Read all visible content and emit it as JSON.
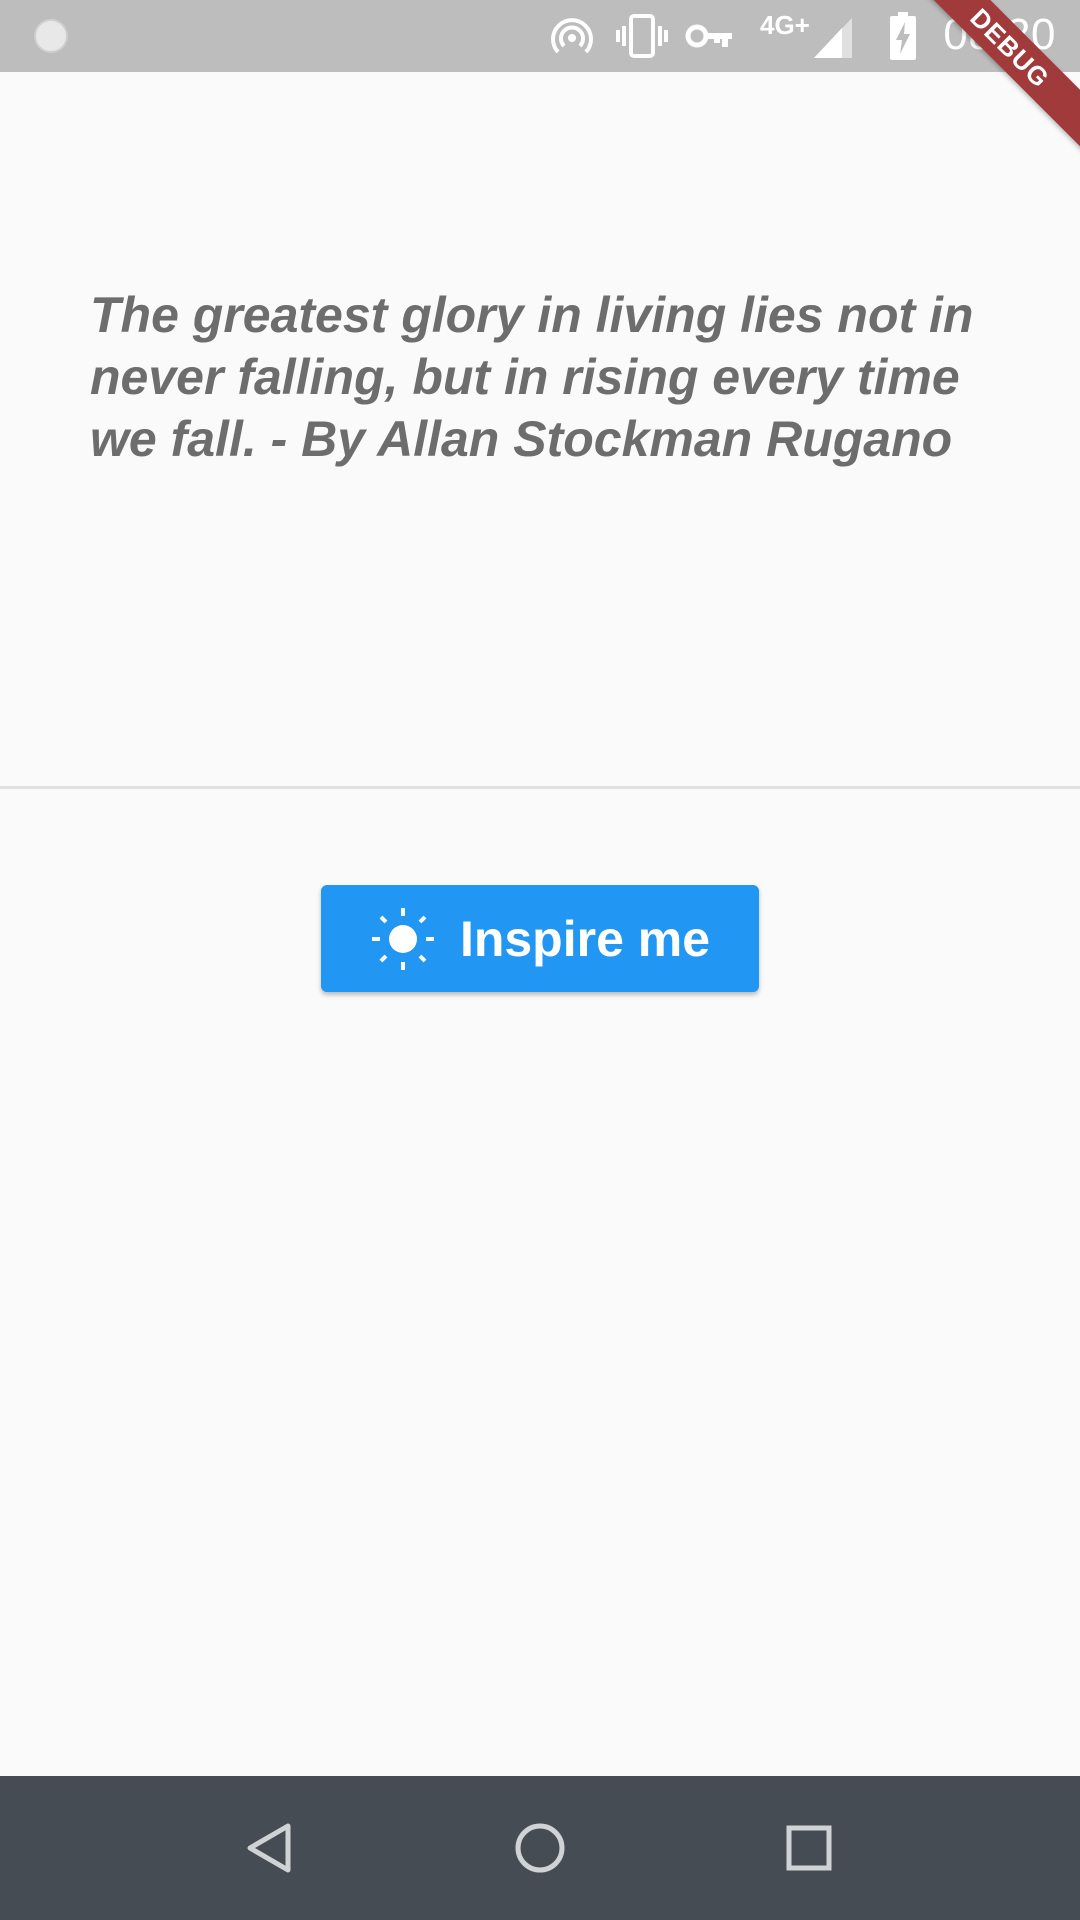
{
  "status_bar": {
    "time": "08:20",
    "network": "4G+",
    "icons": [
      "notification-dot-icon",
      "hotspot-icon",
      "vibrate-icon",
      "vpn-key-icon",
      "cell-signal-icon",
      "battery-charging-icon"
    ]
  },
  "debug_banner": "DEBUG",
  "quote": {
    "text": "The greatest glory in living lies not in never falling, but in rising every time we fall. - By Allan Stockman Rugano"
  },
  "button": {
    "label": "Inspire me",
    "icon": "sun-icon",
    "color": "#2196f3"
  },
  "nav_bar": {
    "items": [
      "back-icon",
      "home-icon",
      "recents-icon"
    ]
  },
  "colors": {
    "status_bar": "#bdbdbd",
    "background": "#fafafa",
    "quote_text": "#6d6d6d",
    "nav_bar": "#454c53",
    "debug_banner": "#a13a3a"
  }
}
